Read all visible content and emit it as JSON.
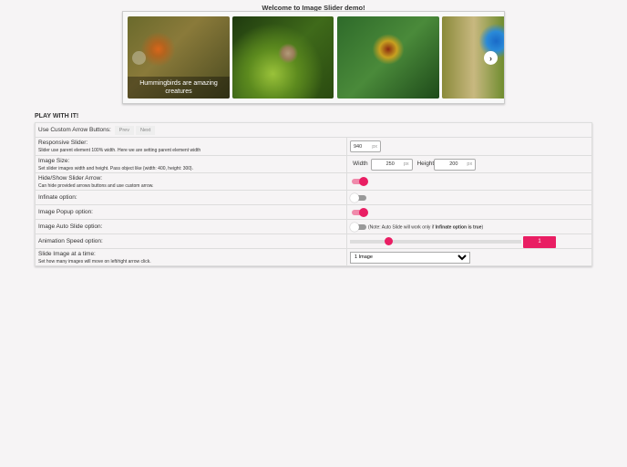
{
  "title": "Welcome to Image Slider demo!",
  "slider": {
    "caption": "Hummingbirds are amazing creatures",
    "images": [
      "hummingbird",
      "squirrel",
      "bird-of-paradise",
      "blue-bird"
    ],
    "next_icon": "chevron-right-icon",
    "prev_icon": "chevron-left-icon"
  },
  "play": {
    "heading": "PLAY WITH IT!",
    "custom_arrows": {
      "label": "Use Custom Arrow Buttons:",
      "prev": "Prev",
      "next": "Next"
    },
    "responsive": {
      "label": "Responsive Slider:",
      "desc": "Slider use parent element 100% width. Here we are setting parent element width",
      "value": "940",
      "unit": "px"
    },
    "image_size": {
      "label": "Image Size:",
      "desc": "Set slider images width and height. Pass object like {width: 400, height: 300}.",
      "width_label": "Width",
      "width": "250",
      "height_label": "Height",
      "height": "200",
      "unit": "px"
    },
    "arrows": {
      "label": "Hide/Show Slider Arrow:",
      "desc": "Can hide provided arrows buttons and use custom arrow.",
      "on": true
    },
    "infinite": {
      "label": "Infinate option:",
      "on": false
    },
    "popup": {
      "label": "Image Popup option:",
      "on": true
    },
    "autoslide": {
      "label": "Image Auto Slide option:",
      "on": false,
      "note_pre": "(Note: Auto Slide will work only if ",
      "note_bold": "Infinate option is true",
      "note_post": ")"
    },
    "speed": {
      "label": "Animation Speed option:",
      "value": "1",
      "fraction": 0.2
    },
    "slide_count": {
      "label": "Slide Image at a time:",
      "desc": "Set how many images will move on left/right arrow click.",
      "selected": "1 Image"
    }
  },
  "colors": {
    "accent": "#e91e63"
  }
}
